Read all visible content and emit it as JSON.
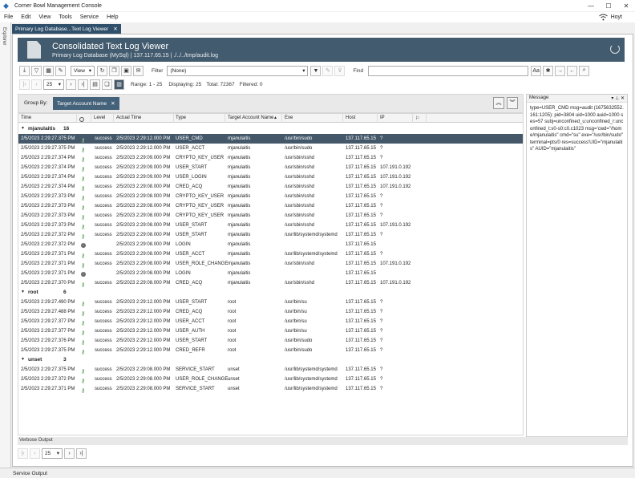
{
  "window": {
    "title": "Corner Bowl Management Console"
  },
  "menu": [
    "File",
    "Edit",
    "View",
    "Tools",
    "Service",
    "Help"
  ],
  "user": {
    "name": "Hoyt"
  },
  "sidebar": {
    "label": "Explorer"
  },
  "tab": {
    "label": "Primary Log Database...Text Log Viewer"
  },
  "header": {
    "title": "Consolidated Text Log Viewer",
    "subtitle": "Primary Log Database (MySql) | 137.117.65.15 | ./../../tmp/audit.log"
  },
  "toolbar": {
    "view_label": "View",
    "filter_label": "Filter",
    "filter_value": "(None)",
    "find_label": "Find",
    "find_value": "",
    "page_size": "25",
    "range": "Range: 1 - 25",
    "displaying": "Displaying: 25",
    "total": "Total: 72367",
    "filtered": "Filtered: 0"
  },
  "groupby": {
    "label": "Group By:",
    "chip": "Target Account Name"
  },
  "columns": [
    "Time",
    "Level",
    "Actual Time",
    "Type",
    "Target Account Name",
    "Exe",
    "Host",
    "IP"
  ],
  "groups": [
    {
      "name": "mjanulaitis",
      "count": "16",
      "rows": [
        {
          "time": "2/5/2023 2:29:27.375 PM",
          "icon": "key",
          "level": "success",
          "actual": "2/5/2023 2:29:12.000 PM",
          "type": "USER_CMD",
          "account": "mjanulaitis",
          "exe": "/usr/bin/sudo",
          "host": "137.117.65.15",
          "ip": "?",
          "sel": true
        },
        {
          "time": "2/5/2023 2:29:27.375 PM",
          "icon": "key",
          "level": "success",
          "actual": "2/5/2023 2:29:12.000 PM",
          "type": "USER_ACCT",
          "account": "mjanulaitis",
          "exe": "/usr/bin/sudo",
          "host": "137.117.65.15",
          "ip": "?"
        },
        {
          "time": "2/5/2023 2:29:27.374 PM",
          "icon": "key",
          "level": "success",
          "actual": "2/5/2023 2:29:09.000 PM",
          "type": "CRYPTO_KEY_USER",
          "account": "mjanulaitis",
          "exe": "/usr/sbin/sshd",
          "host": "137.117.65.15",
          "ip": "?"
        },
        {
          "time": "2/5/2023 2:29:27.374 PM",
          "icon": "key",
          "level": "success",
          "actual": "2/5/2023 2:29:09.000 PM",
          "type": "USER_START",
          "account": "mjanulaitis",
          "exe": "/usr/sbin/sshd",
          "host": "137.117.65.15",
          "ip": "107.191.0.192"
        },
        {
          "time": "2/5/2023 2:29:27.374 PM",
          "icon": "key",
          "level": "success",
          "actual": "2/5/2023 2:29:09.000 PM",
          "type": "USER_LOGIN",
          "account": "mjanulaitis",
          "exe": "/usr/sbin/sshd",
          "host": "137.117.65.15",
          "ip": "107.191.0.192"
        },
        {
          "time": "2/5/2023 2:29:27.374 PM",
          "icon": "key",
          "level": "success",
          "actual": "2/5/2023 2:29:08.000 PM",
          "type": "CRED_ACQ",
          "account": "mjanulaitis",
          "exe": "/usr/sbin/sshd",
          "host": "137.117.65.15",
          "ip": "107.191.0.192"
        },
        {
          "time": "2/5/2023 2:29:27.373 PM",
          "icon": "key",
          "level": "success",
          "actual": "2/5/2023 2:29:08.000 PM",
          "type": "CRYPTO_KEY_USER",
          "account": "mjanulaitis",
          "exe": "/usr/sbin/sshd",
          "host": "137.117.65.15",
          "ip": "?"
        },
        {
          "time": "2/5/2023 2:29:27.373 PM",
          "icon": "key",
          "level": "success",
          "actual": "2/5/2023 2:29:08.000 PM",
          "type": "CRYPTO_KEY_USER",
          "account": "mjanulaitis",
          "exe": "/usr/sbin/sshd",
          "host": "137.117.65.15",
          "ip": "?"
        },
        {
          "time": "2/5/2023 2:29:27.373 PM",
          "icon": "key",
          "level": "success",
          "actual": "2/5/2023 2:29:08.000 PM",
          "type": "CRYPTO_KEY_USER",
          "account": "mjanulaitis",
          "exe": "/usr/sbin/sshd",
          "host": "137.117.65.15",
          "ip": "?"
        },
        {
          "time": "2/5/2023 2:29:27.373 PM",
          "icon": "key",
          "level": "success",
          "actual": "2/5/2023 2:29:08.000 PM",
          "type": "USER_START",
          "account": "mjanulaitis",
          "exe": "/usr/sbin/sshd",
          "host": "137.117.65.15",
          "ip": "107.191.0.192"
        },
        {
          "time": "2/5/2023 2:29:27.372 PM",
          "icon": "key",
          "level": "success",
          "actual": "2/5/2023 2:29:08.000 PM",
          "type": "USER_START",
          "account": "mjanulaitis",
          "exe": "/usr/lib/systemd/systemd",
          "host": "137.117.65.15",
          "ip": "?"
        },
        {
          "time": "2/5/2023 2:29:27.372 PM",
          "icon": "info",
          "level": "",
          "actual": "2/5/2023 2:29:08.000 PM",
          "type": "LOGIN",
          "account": "mjanulaitis",
          "exe": "",
          "host": "137.117.65.15",
          "ip": ""
        },
        {
          "time": "2/5/2023 2:29:27.371 PM",
          "icon": "key",
          "level": "success",
          "actual": "2/5/2023 2:29:08.000 PM",
          "type": "USER_ACCT",
          "account": "mjanulaitis",
          "exe": "/usr/lib/systemd/systemd",
          "host": "137.117.65.15",
          "ip": "?"
        },
        {
          "time": "2/5/2023 2:29:27.371 PM",
          "icon": "key",
          "level": "success",
          "actual": "2/5/2023 2:29:08.000 PM",
          "type": "USER_ROLE_CHANGE",
          "account": "mjanulaitis",
          "exe": "/usr/sbin/sshd",
          "host": "137.117.65.15",
          "ip": "107.191.0.192"
        },
        {
          "time": "2/5/2023 2:29:27.371 PM",
          "icon": "info",
          "level": "",
          "actual": "2/5/2023 2:29:08.000 PM",
          "type": "LOGIN",
          "account": "mjanulaitis",
          "exe": "",
          "host": "137.117.65.15",
          "ip": ""
        },
        {
          "time": "2/5/2023 2:29:27.370 PM",
          "icon": "key",
          "level": "success",
          "actual": "2/5/2023 2:29:08.000 PM",
          "type": "CRED_ACQ",
          "account": "mjanulaitis",
          "exe": "/usr/sbin/sshd",
          "host": "137.117.65.15",
          "ip": "107.191.0.192"
        }
      ]
    },
    {
      "name": "root",
      "count": "6",
      "rows": [
        {
          "time": "2/5/2023 2:29:27.490 PM",
          "icon": "key",
          "level": "success",
          "actual": "2/5/2023 2:29:12.000 PM",
          "type": "USER_START",
          "account": "root",
          "exe": "/usr/bin/su",
          "host": "137.117.65.15",
          "ip": "?"
        },
        {
          "time": "2/5/2023 2:29:27.488 PM",
          "icon": "key",
          "level": "success",
          "actual": "2/5/2023 2:29:12.000 PM",
          "type": "CRED_ACQ",
          "account": "root",
          "exe": "/usr/bin/su",
          "host": "137.117.65.15",
          "ip": "?"
        },
        {
          "time": "2/5/2023 2:29:27.377 PM",
          "icon": "key",
          "level": "success",
          "actual": "2/5/2023 2:29:12.000 PM",
          "type": "USER_ACCT",
          "account": "root",
          "exe": "/usr/bin/su",
          "host": "137.117.65.15",
          "ip": "?"
        },
        {
          "time": "2/5/2023 2:29:27.377 PM",
          "icon": "key",
          "level": "success",
          "actual": "2/5/2023 2:29:12.000 PM",
          "type": "USER_AUTH",
          "account": "root",
          "exe": "/usr/bin/su",
          "host": "137.117.65.15",
          "ip": "?"
        },
        {
          "time": "2/5/2023 2:29:27.376 PM",
          "icon": "key",
          "level": "success",
          "actual": "2/5/2023 2:29:12.000 PM",
          "type": "USER_START",
          "account": "root",
          "exe": "/usr/bin/sudo",
          "host": "137.117.65.15",
          "ip": "?"
        },
        {
          "time": "2/5/2023 2:29:27.375 PM",
          "icon": "key",
          "level": "success",
          "actual": "2/5/2023 2:29:12.000 PM",
          "type": "CRED_REFR",
          "account": "root",
          "exe": "/usr/bin/sudo",
          "host": "137.117.65.15",
          "ip": "?"
        }
      ]
    },
    {
      "name": "unset",
      "count": "3",
      "rows": [
        {
          "time": "2/5/2023 2:29:27.375 PM",
          "icon": "key",
          "level": "success",
          "actual": "2/5/2023 2:29:08.000 PM",
          "type": "SERVICE_START",
          "account": "unset",
          "exe": "/usr/lib/systemd/systemd",
          "host": "137.117.65.15",
          "ip": "?"
        },
        {
          "time": "2/5/2023 2:29:27.372 PM",
          "icon": "key",
          "level": "success",
          "actual": "2/5/2023 2:29:08.000 PM",
          "type": "USER_ROLE_CHANGE",
          "account": "unset",
          "exe": "/usr/lib/systemd/systemd",
          "host": "137.117.65.15",
          "ip": "?"
        },
        {
          "time": "2/5/2023 2:29:27.371 PM",
          "icon": "key",
          "level": "success",
          "actual": "2/5/2023 2:29:08.000 PM",
          "type": "SERVICE_START",
          "account": "unset",
          "exe": "/usr/lib/systemd/systemd",
          "host": "137.117.65.15",
          "ip": "?"
        }
      ]
    }
  ],
  "message": {
    "title": "Message",
    "text": "type=USER_CMD msg=audit (1675632552.161:1205): pid=3804 uid=1000 auid=1000 ses=57 subj=unconfined_u:unconfined_r:unconfined_t:s0-s0:c0.c1023 msg='cwd=\"/home/mjanulaitis\" cmd=\"su\" exe=\"/usr/bin/sudo\" terminal=pts/0 res=success'UID=\"mjanulaitis\" AUID=\"mjanulaitis\""
  },
  "verbose": {
    "label": "Verbose Output",
    "page_size": "25"
  },
  "status": {
    "label": "Service Output"
  },
  "colors": {
    "header_bg": "#435b6e",
    "selected_row": "#44586a",
    "chip": "#44627a",
    "success": "#3f8f3a"
  }
}
